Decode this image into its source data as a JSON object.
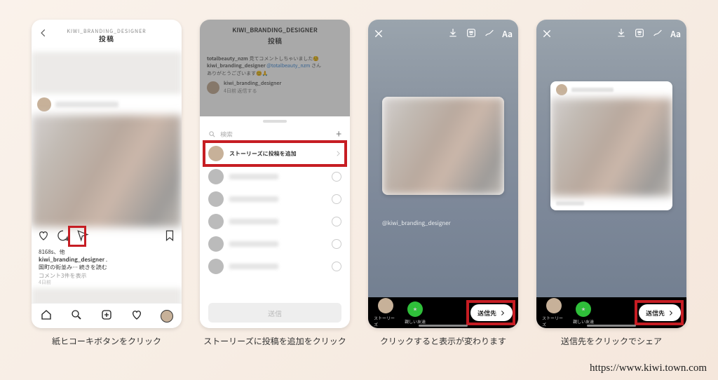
{
  "header_small": "KIWI_BRANDING_DESIGNER",
  "header_title": "投稿",
  "phone1": {
    "username": "kiwi_branding_designer",
    "likes_suffix": "8168s、他",
    "desc": "国町の街並み…  続きを読む",
    "comment_link": "コメント3件を表示",
    "time": "4日前"
  },
  "phone2": {
    "bg_comment_user": "totalbeauty_nzm",
    "bg_comment": "見てコメントしちゃいました☺️",
    "bg_reply_user": "kiwi_branding_designer",
    "bg_reply_mention": "@totalbeauty_nzm",
    "bg_reply_tail": "さん",
    "bg_thanks": "ありがとうございます😊🙏",
    "bg_row_user": "kiwi_branding_designer",
    "bg_row_sub": "4日前 返信する",
    "search_ph": "検索",
    "story_add": "ストーリーズに投稿を追加",
    "send_btn": "送信"
  },
  "story": {
    "label": "@kiwi_branding_designer",
    "bottom_story": "ストーリーズ",
    "bottom_close": "親しい友達",
    "send_to": "送信先"
  },
  "captions": {
    "c1": "紙ヒコーキボタンをクリック",
    "c2": "ストーリーズに投稿を追加をクリック",
    "c3": "クリックすると表示が変わります",
    "c4": "送信先をクリックでシェア"
  },
  "footer_url": "https://www.kiwi.town.com"
}
